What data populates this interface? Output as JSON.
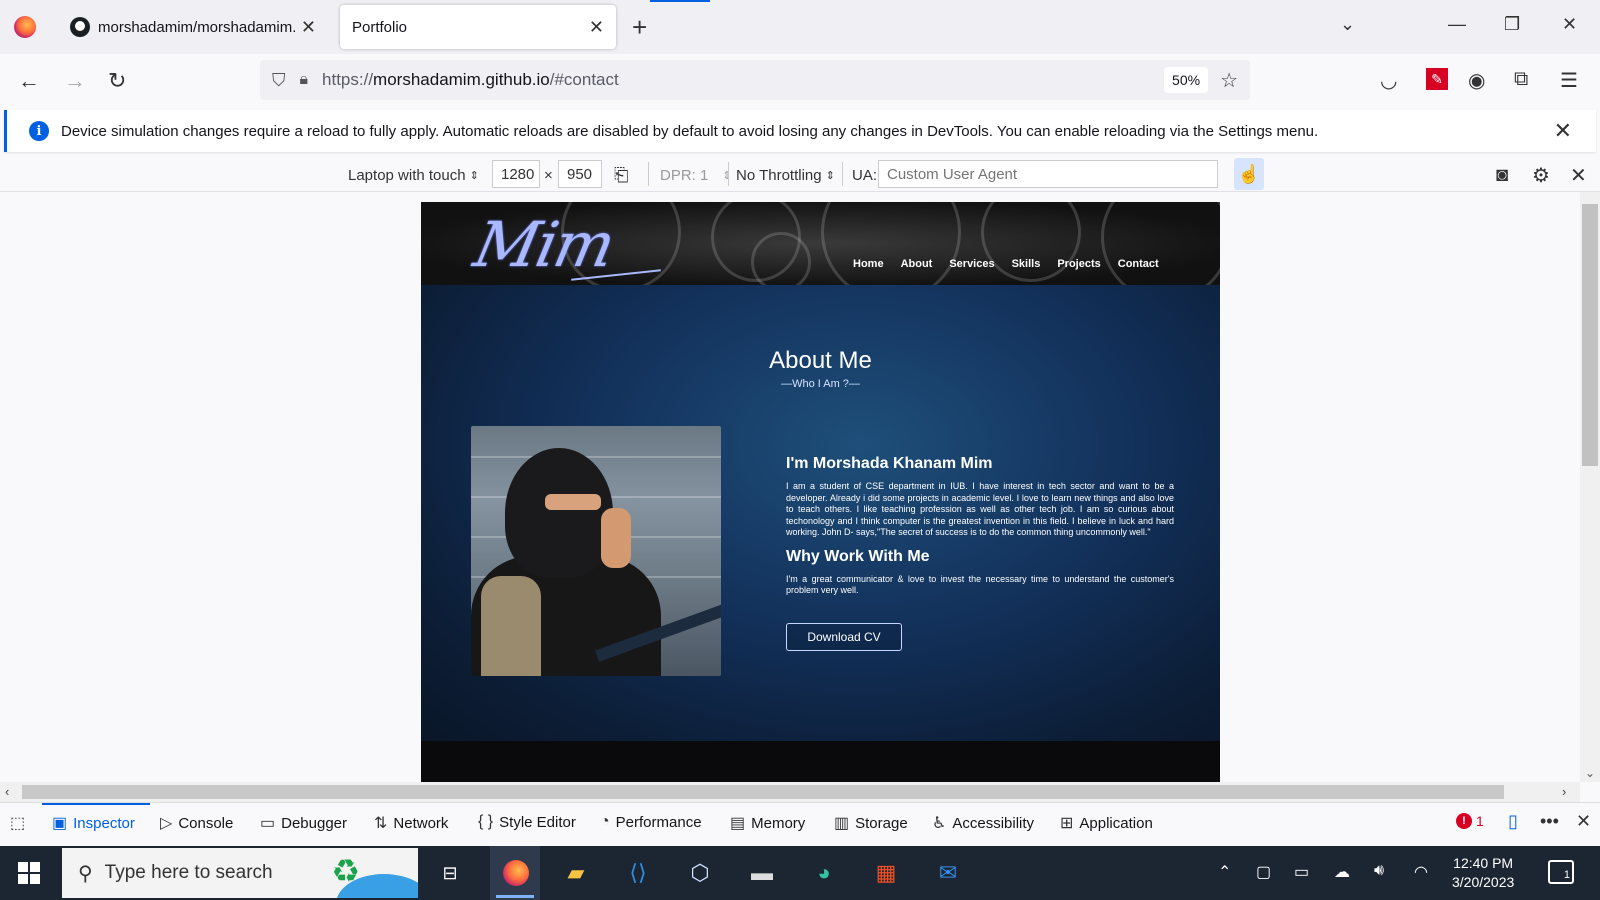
{
  "browser": {
    "tabs": [
      {
        "title": "morshadamim/morshadamim.g",
        "active": false
      },
      {
        "title": "Portfolio",
        "active": true
      }
    ],
    "new_tab_icon": "plus-icon",
    "url_prefix": "https://",
    "url_host": "morshadamim.github.io",
    "url_path": "/#contact",
    "zoom": "50%"
  },
  "infobar": {
    "message": "Device simulation changes require a reload to fully apply. Automatic reloads are disabled by default to avoid losing any changes in DevTools. You can enable reloading via the Settings menu."
  },
  "rdm": {
    "device": "Laptop with touch",
    "width": "1280",
    "times": "×",
    "height": "950",
    "dpr": "DPR: 1",
    "throttling": "No Throttling",
    "ua_label": "UA:",
    "ua_placeholder": "Custom User Agent"
  },
  "site": {
    "logo": "Mim",
    "nav": [
      "Home",
      "About",
      "Services",
      "Skills",
      "Projects",
      "Contact"
    ],
    "about_title": "About Me",
    "about_subtitle": "—Who I Am ?—",
    "name_heading": "I'm Morshada Khanam Mim",
    "bio": "I am a student of CSE department in IUB. I have interest in tech sector and want to be a developer. Already i did some projects in academic level. I love to learn new things and also love to teach others. I like teaching profession as well as other tech job. I am so curious about techonology and I think computer is the greatest invention in this field. I believe in luck and hard working. John D- says,\"The secret of success is to do the common thing uncommonly well.\"",
    "why_heading": "Why Work With Me",
    "why_text": "I'm a great communicator & love to invest the necessary time to understand the customer's problem very well.",
    "cv_button": "Download CV"
  },
  "devtools": {
    "tabs": [
      "Inspector",
      "Console",
      "Debugger",
      "Network",
      "Style Editor",
      "Performance",
      "Memory",
      "Storage",
      "Accessibility",
      "Application"
    ],
    "selected_tab": "Inspector",
    "error_count": "1"
  },
  "taskbar": {
    "search_placeholder": "Type here to search",
    "time": "12:40 PM",
    "date": "3/20/2023",
    "notification_count": "1"
  },
  "colors": {
    "accent": "#0061e0",
    "error": "#d70022",
    "site_bg": "#12305a"
  }
}
